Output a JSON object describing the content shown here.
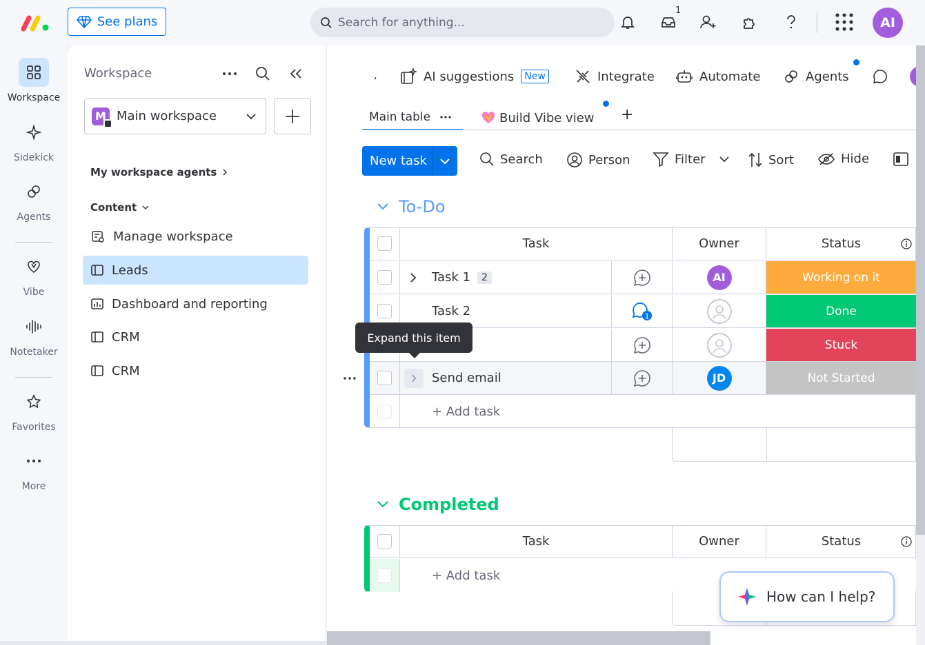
{
  "colors": {
    "accent": "#0073ea",
    "todo": "#579bfc",
    "completed": "#00c875",
    "working": "#fdab3d",
    "done": "#00c875",
    "stuck": "#e2445c",
    "not_started": "#c4c4c4",
    "avatar_ai": "#a25ddc",
    "avatar_jd": "#0086f0"
  },
  "topbar": {
    "see_plans": "See plans",
    "search_placeholder": "Search for anything...",
    "inbox_count": "1",
    "avatar": "AI",
    "icons": [
      "monday-logo",
      "bell-icon",
      "inbox-icon",
      "invite-icon",
      "puzzle-icon",
      "help-icon",
      "apps-grid-icon"
    ]
  },
  "rail": {
    "items": [
      {
        "label": "Workspace",
        "icon": "grid-icon"
      },
      {
        "label": "Sidekick",
        "icon": "sparkle-icon"
      },
      {
        "label": "Agents",
        "icon": "agents-icon"
      },
      {
        "label": "Vibe",
        "icon": "vibe-icon"
      },
      {
        "label": "Notetaker",
        "icon": "waveform-icon"
      },
      {
        "label": "Favorites",
        "icon": "star-icon"
      },
      {
        "label": "More",
        "icon": "more-dots-icon"
      }
    ]
  },
  "panel": {
    "title": "Workspace",
    "workspace_initial": "M",
    "workspace_name": "Main workspace",
    "agents_link": "My workspace agents",
    "content_label": "Content",
    "items": [
      {
        "label": "Manage workspace",
        "icon": "manage-icon"
      },
      {
        "label": "Leads",
        "icon": "board-icon"
      },
      {
        "label": "Dashboard and reporting",
        "icon": "dashboard-icon"
      },
      {
        "label": "CRM",
        "icon": "board-icon"
      },
      {
        "label": "CRM",
        "icon": "board-icon"
      }
    ]
  },
  "main": {
    "toolbar": {
      "ai_suggestions": "AI suggestions",
      "new_badge": "New",
      "integrate": "Integrate",
      "automate": "Automate",
      "agents": "Agents"
    },
    "tabs": {
      "main_table": "Main table",
      "vibe": "Build Vibe view",
      "add": "+"
    },
    "actions": {
      "new_task": "New task",
      "search": "Search",
      "person": "Person",
      "filter": "Filter",
      "sort": "Sort",
      "hide": "Hide"
    },
    "groups": [
      {
        "title": "To-Do",
        "columns": [
          "Task",
          "Owner",
          "Status"
        ],
        "rows": [
          {
            "task": "Task 1",
            "subitems": "2",
            "owner": "AI",
            "status": "Working on it"
          },
          {
            "task": "Task 2",
            "updates": "1",
            "owner": "",
            "status": "Done"
          },
          {
            "task": "",
            "owner": "",
            "status": "Stuck"
          },
          {
            "task": "Send email",
            "owner": "JD",
            "status": "Not Started"
          }
        ],
        "add_task": "+ Add task"
      },
      {
        "title": "Completed",
        "columns": [
          "Task",
          "Owner",
          "Status"
        ],
        "rows": [],
        "add_task": "+ Add task"
      }
    ],
    "tooltip": "Expand this item"
  },
  "help": {
    "label": "How can I help?"
  }
}
